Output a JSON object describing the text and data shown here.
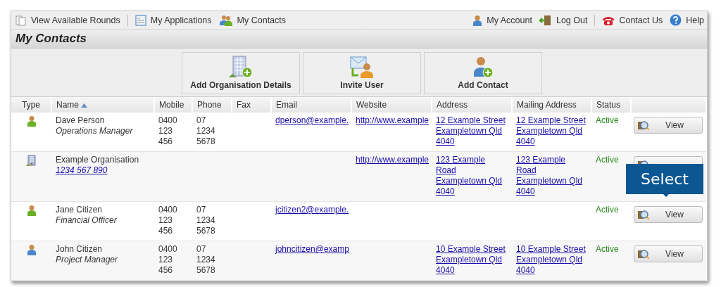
{
  "nav_left": [
    {
      "label": "View Available Rounds"
    },
    {
      "label": "My Applications"
    },
    {
      "label": "My Contacts"
    }
  ],
  "nav_right": [
    {
      "label": "My Account"
    },
    {
      "label": "Log Out"
    },
    {
      "label": "Contact Us"
    },
    {
      "label": "Help"
    }
  ],
  "page_title": "My Contacts",
  "actions": [
    {
      "label": "Add Organisation Details"
    },
    {
      "label": "Invite User"
    },
    {
      "label": "Add Contact"
    }
  ],
  "table": {
    "columns": [
      {
        "label": "Type",
        "sorted": false
      },
      {
        "label": "Name",
        "sorted": true
      },
      {
        "label": "Mobile",
        "sorted": false
      },
      {
        "label": "Phone",
        "sorted": false
      },
      {
        "label": "Fax",
        "sorted": false
      },
      {
        "label": "Email",
        "sorted": false
      },
      {
        "label": "Website",
        "sorted": false
      },
      {
        "label": "Address",
        "sorted": false
      },
      {
        "label": "Mailing Address",
        "sorted": false
      },
      {
        "label": "Status",
        "sorted": false
      }
    ],
    "rows": [
      {
        "kind": "person",
        "name": "Dave Person",
        "subtitle": "Operations Manager",
        "mobile": [
          "0400",
          "123",
          "456"
        ],
        "phone": [
          "07",
          "1234",
          "5678"
        ],
        "email": "dperson@example.",
        "website": "http://www.example",
        "address": [
          "12 Example Street",
          "Exampletown Qld",
          "4040"
        ],
        "mailing_address": [
          "12 Example Street",
          "Exampletown Qld",
          "4040"
        ],
        "status": "Active",
        "button": "View"
      },
      {
        "kind": "organisation",
        "name": "Example Organisation",
        "abn": "1234 567 890",
        "website": "http://www.example",
        "address": [
          "123 Example",
          "Road",
          "Exampletown Qld",
          "4040"
        ],
        "mailing_address": [
          "123 Example",
          "Road",
          "Exampletown Qld",
          "4040"
        ],
        "status": "Active"
      },
      {
        "kind": "person",
        "name": "Jane Citizen",
        "subtitle": "Financial Officer",
        "mobile": [
          "0400",
          "123",
          "456"
        ],
        "phone": [
          "07",
          "1234",
          "5678"
        ],
        "email": "jcitizen2@example.",
        "status": "Active",
        "button": "View"
      },
      {
        "kind": "account_holder",
        "name": "John Citizen",
        "subtitle": "Project Manager",
        "mobile": [
          "0400",
          "123",
          "456"
        ],
        "phone": [
          "07",
          "1234",
          "5678"
        ],
        "email": "johncitizen@examp",
        "address": [
          "10 Example Street",
          "Exampletown Qld",
          "4040"
        ],
        "mailing_address": [
          "10 Example Street",
          "Exampletown Qld",
          "4040"
        ],
        "status": "Active",
        "button": "View"
      }
    ]
  },
  "callout": {
    "label": "Select"
  }
}
